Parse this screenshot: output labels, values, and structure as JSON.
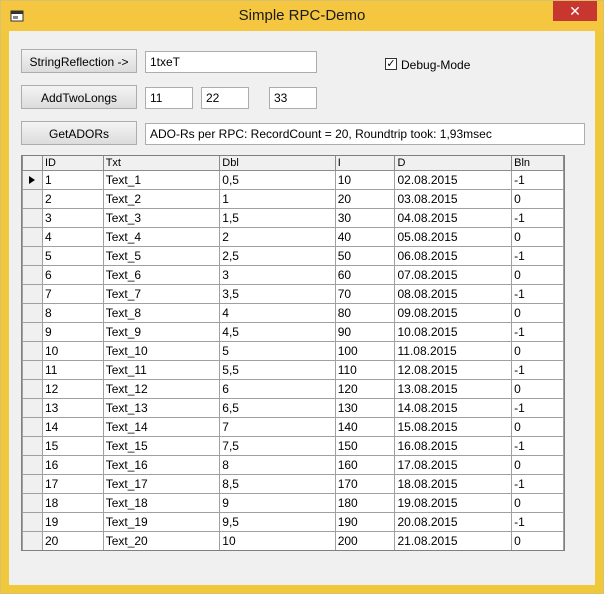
{
  "window": {
    "title": "Simple RPC-Demo",
    "close_label": "✕"
  },
  "buttons": {
    "string_reflection": "StringReflection ->",
    "add_two_longs": "AddTwoLongs",
    "get_adors": "GetADORs"
  },
  "fields": {
    "reflection_result": "1txeT",
    "long_a": "11",
    "long_b": "22",
    "long_sum": "33",
    "ado_status": "ADO-Rs per RPC: RecordCount = 20, Roundtrip took: 1,93msec"
  },
  "debug_mode": {
    "label": "Debug-Mode",
    "checked": true
  },
  "grid": {
    "columns": [
      "ID",
      "Txt",
      "Dbl",
      "I",
      "D",
      "Bln"
    ],
    "rows": [
      [
        "1",
        "Text_1",
        "0,5",
        "10",
        "02.08.2015",
        "-1"
      ],
      [
        "2",
        "Text_2",
        "1",
        "20",
        "03.08.2015",
        "0"
      ],
      [
        "3",
        "Text_3",
        "1,5",
        "30",
        "04.08.2015",
        "-1"
      ],
      [
        "4",
        "Text_4",
        "2",
        "40",
        "05.08.2015",
        "0"
      ],
      [
        "5",
        "Text_5",
        "2,5",
        "50",
        "06.08.2015",
        "-1"
      ],
      [
        "6",
        "Text_6",
        "3",
        "60",
        "07.08.2015",
        "0"
      ],
      [
        "7",
        "Text_7",
        "3,5",
        "70",
        "08.08.2015",
        "-1"
      ],
      [
        "8",
        "Text_8",
        "4",
        "80",
        "09.08.2015",
        "0"
      ],
      [
        "9",
        "Text_9",
        "4,5",
        "90",
        "10.08.2015",
        "-1"
      ],
      [
        "10",
        "Text_10",
        "5",
        "100",
        "11.08.2015",
        "0"
      ],
      [
        "11",
        "Text_11",
        "5,5",
        "110",
        "12.08.2015",
        "-1"
      ],
      [
        "12",
        "Text_12",
        "6",
        "120",
        "13.08.2015",
        "0"
      ],
      [
        "13",
        "Text_13",
        "6,5",
        "130",
        "14.08.2015",
        "-1"
      ],
      [
        "14",
        "Text_14",
        "7",
        "140",
        "15.08.2015",
        "0"
      ],
      [
        "15",
        "Text_15",
        "7,5",
        "150",
        "16.08.2015",
        "-1"
      ],
      [
        "16",
        "Text_16",
        "8",
        "160",
        "17.08.2015",
        "0"
      ],
      [
        "17",
        "Text_17",
        "8,5",
        "170",
        "18.08.2015",
        "-1"
      ],
      [
        "18",
        "Text_18",
        "9",
        "180",
        "19.08.2015",
        "0"
      ],
      [
        "19",
        "Text_19",
        "9,5",
        "190",
        "20.08.2015",
        "-1"
      ],
      [
        "20",
        "Text_20",
        "10",
        "200",
        "21.08.2015",
        "0"
      ]
    ],
    "current_row_index": 0
  }
}
